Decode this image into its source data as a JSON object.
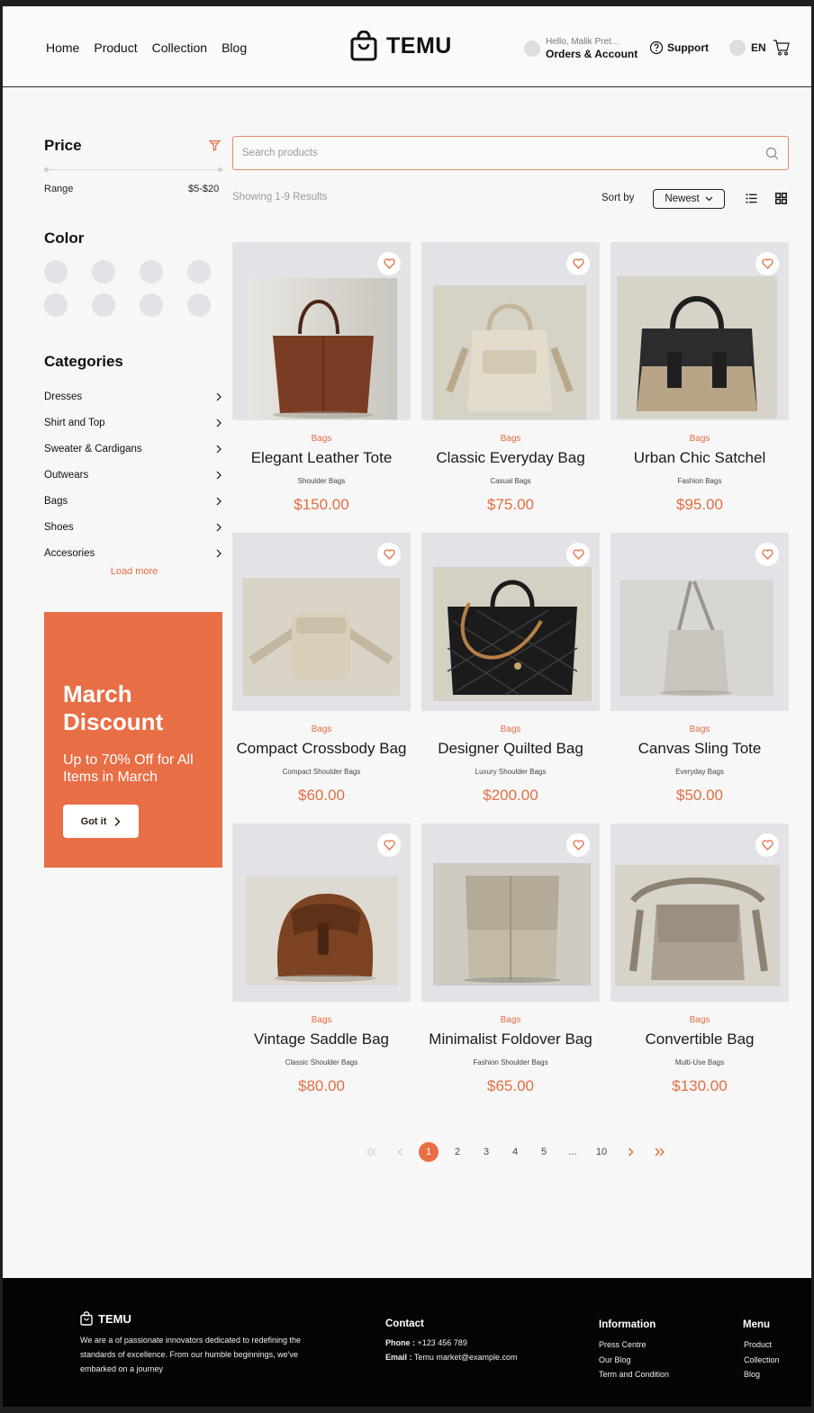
{
  "header": {
    "nav": [
      "Home",
      "Product",
      "Collection",
      "Blog"
    ],
    "brand": "TEMU",
    "greeting": "Hello, Malik Pret...",
    "account": "Orders & Account",
    "support": "Support",
    "language": "EN"
  },
  "sidebar": {
    "price_title": "Price",
    "range_label": "Range",
    "range_value": "$5-$20",
    "color_title": "Color",
    "color_count": 8,
    "categories_title": "Categories",
    "categories": [
      "Dresses",
      "Shirt and Top",
      "Sweater & Cardigans",
      "Outwears",
      "Bags",
      "Shoes",
      "Accesories"
    ],
    "load_more": "Load more"
  },
  "promo": {
    "title_line1": "March",
    "title_line2": "Discount",
    "subtitle": "Up to 70% Off for All Items in March",
    "button": "Got it"
  },
  "search": {
    "placeholder": "Search products"
  },
  "toolbar": {
    "results": "Showing 1-9 Results",
    "sort_label": "Sort by",
    "sort_value": "Newest"
  },
  "products": [
    {
      "category": "Bags",
      "name": "Elegant Leather Tote",
      "type": "Shoulder Bags",
      "price": "$150.00"
    },
    {
      "category": "Bags",
      "name": "Classic Everyday Bag",
      "type": "Casual Bags",
      "price": "$75.00"
    },
    {
      "category": "Bags",
      "name": "Urban Chic Satchel",
      "type": "Fashion Bags",
      "price": "$95.00"
    },
    {
      "category": "Bags",
      "name": "Compact Crossbody Bag",
      "type": "Compact Shoulder Bags",
      "price": "$60.00"
    },
    {
      "category": "Bags",
      "name": "Designer Quilted Bag",
      "type": "Luxury Shoulder Bags",
      "price": "$200.00"
    },
    {
      "category": "Bags",
      "name": "Canvas Sling Tote",
      "type": "Everyday Bags",
      "price": "$50.00"
    },
    {
      "category": "Bags",
      "name": "Vintage Saddle Bag",
      "type": "Classic Shoulder Bags",
      "price": "$80.00"
    },
    {
      "category": "Bags",
      "name": "Minimalist Foldover Bag",
      "type": "Fashion Shoulder Bags",
      "price": "$65.00"
    },
    {
      "category": "Bags",
      "name": "Convertible Bag",
      "type": "Multi-Use Bags",
      "price": "$130.00"
    }
  ],
  "pagination": {
    "pages": [
      "1",
      "2",
      "3",
      "4",
      "5",
      "...",
      "10"
    ],
    "current": "1",
    "first_icon": "double-chevron-left-icon",
    "prev_icon": "chevron-left-icon",
    "next_icon": "chevron-right-icon",
    "last_icon": "double-chevron-right-icon"
  },
  "footer": {
    "brand": "TEMU",
    "about": "We are a of passionate innovators dedicated to redefining the standards of excellence. From our humble beginnings, we've embarked on a journey",
    "contact_title": "Contact",
    "phone_label": "Phone :",
    "phone": "+123 456 789",
    "email_label": "Email :",
    "email": "Temu market@example.com",
    "info_title": "Information",
    "info_links": [
      "Press Centre",
      "Our Blog",
      "Term and Condition"
    ],
    "menu_title": "Menu",
    "menu_links": [
      "Product",
      "Collection",
      "Blog"
    ]
  },
  "colors": {
    "accent": "#e86e45",
    "card_bg": "#e3e2e7",
    "footer_bg": "#050505"
  }
}
